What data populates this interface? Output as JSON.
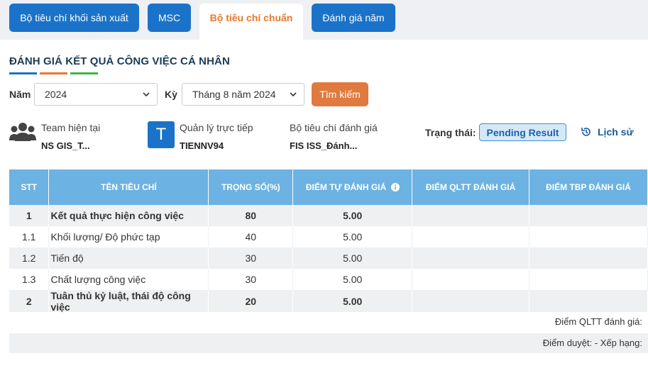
{
  "tabs": [
    {
      "label": "Bộ tiêu chí khối sản xuất",
      "active": false
    },
    {
      "label": "MSC",
      "active": false
    },
    {
      "label": "Bộ tiêu chí chuẩn",
      "active": true
    },
    {
      "label": "Đánh giá năm",
      "active": false
    }
  ],
  "page": {
    "title": "ĐÁNH GIÁ KẾT QUẢ CÔNG VIỆC CÁ NHÂN",
    "underline_colors": [
      "#1a73c9",
      "#e8782f",
      "#3bb54a"
    ]
  },
  "filters": {
    "year_label": "Năm",
    "year_value": "2024",
    "period_label": "Kỳ",
    "period_value": "Tháng 8 năm 2024",
    "search_label": "Tìm kiếm"
  },
  "info": {
    "team_label": "Team hiện tại",
    "team_value": "NS GIS_T...",
    "manager_avatar": "T",
    "manager_label": "Quản lý trực tiếp",
    "manager_value": "TIENNV94",
    "criteria_label": "Bộ tiêu chí đánh giá",
    "criteria_value": "FIS ISS_Đánh...",
    "status_label": "Trạng thái:",
    "status_value": "Pending Result",
    "history_label": "Lịch sử"
  },
  "table": {
    "headers": [
      "STT",
      "TÊN TIÊU CHÍ",
      "TRỌNG SỐ(%)",
      "ĐIỂM TỰ ĐÁNH GIÁ",
      "ĐIỂM QLTT ĐÁNH GIÁ",
      "ĐIỂM TBP ĐÁNH GIÁ"
    ],
    "rows": [
      {
        "stt": "1",
        "name": "Kết quả thực hiện công việc",
        "weight": "80",
        "self": "5.00",
        "qltt": "",
        "tbp": "",
        "bold": true
      },
      {
        "stt": "1.1",
        "name": "Khối lượng/ Độ phức tạp",
        "weight": "40",
        "self": "5.00",
        "qltt": "",
        "tbp": "",
        "bold": false
      },
      {
        "stt": "1.2",
        "name": "Tiến độ",
        "weight": "30",
        "self": "5.00",
        "qltt": "",
        "tbp": "",
        "bold": false
      },
      {
        "stt": "1.3",
        "name": "Chất lượng công việc",
        "weight": "30",
        "self": "5.00",
        "qltt": "",
        "tbp": "",
        "bold": false
      },
      {
        "stt": "2",
        "name": "Tuân thủ kỷ luật, thái độ công việc",
        "weight": "20",
        "self": "5.00",
        "qltt": "",
        "tbp": "",
        "bold": true
      }
    ]
  },
  "footer": {
    "qltt_score": "Điểm QLTT đánh giá:",
    "approved": "Điểm duyệt: - Xếp hạng:"
  },
  "colors": {
    "primary": "#1a73c9",
    "accent": "#e07a3f",
    "header_bg": "#6cb2e2"
  }
}
